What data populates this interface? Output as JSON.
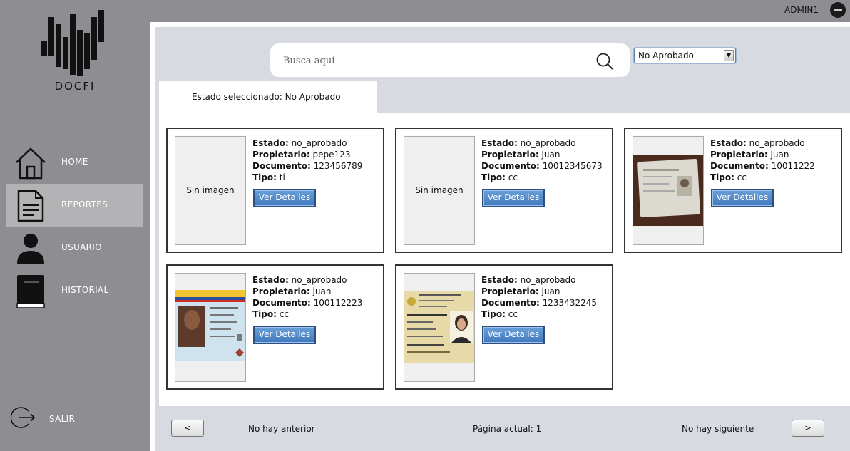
{
  "header": {
    "user_name": "ADMIN1",
    "user_toggle_icon": "minus-circle-icon"
  },
  "sidebar": {
    "logo_text": "DOCFI",
    "items": [
      {
        "label": "HOME",
        "icon": "home-icon"
      },
      {
        "label": "REPORTES",
        "icon": "document-icon",
        "active": true
      },
      {
        "label": "USUARIO",
        "icon": "user-icon"
      },
      {
        "label": "HISTORIAL",
        "icon": "book-icon"
      }
    ],
    "logout": {
      "label": "SALIR",
      "icon": "logout-icon"
    }
  },
  "search": {
    "placeholder": "Busca aquí",
    "value": ""
  },
  "filter": {
    "selected": "No Aprobado"
  },
  "tab": {
    "label": "Estado seleccionado: No Aprobado"
  },
  "labels": {
    "estado": "Estado:",
    "propietario": "Propietario:",
    "documento": "Documento:",
    "tipo": "Tipo:",
    "details_button": "Ver Detalles",
    "no_image": "Sin imagen"
  },
  "cards": [
    {
      "estado": "no_aprobado",
      "propietario": "pepe123",
      "documento": "123456789",
      "tipo": "ti",
      "has_image": false
    },
    {
      "estado": "no_aprobado",
      "propietario": "juan",
      "documento": "10012345673",
      "tipo": "cc",
      "has_image": false
    },
    {
      "estado": "no_aprobado",
      "propietario": "juan",
      "documento": "10011222",
      "tipo": "cc",
      "has_image": true
    },
    {
      "estado": "no_aprobado",
      "propietario": "juan",
      "documento": "100112223",
      "tipo": "cc",
      "has_image": true
    },
    {
      "estado": "no_aprobado",
      "propietario": "juan",
      "documento": "1233432245",
      "tipo": "cc",
      "has_image": true
    }
  ],
  "pagination": {
    "prev_label": "<",
    "next_label": ">",
    "prev_text": "No hay anterior",
    "current_text": "Página actual: 1",
    "next_text": "No hay siguiente"
  },
  "colors": {
    "sidebar_bg": "#8e8e92",
    "active_item": "#b3b3b6",
    "button_blue": "#3f78bd",
    "content_bg": "#d7dae0"
  }
}
